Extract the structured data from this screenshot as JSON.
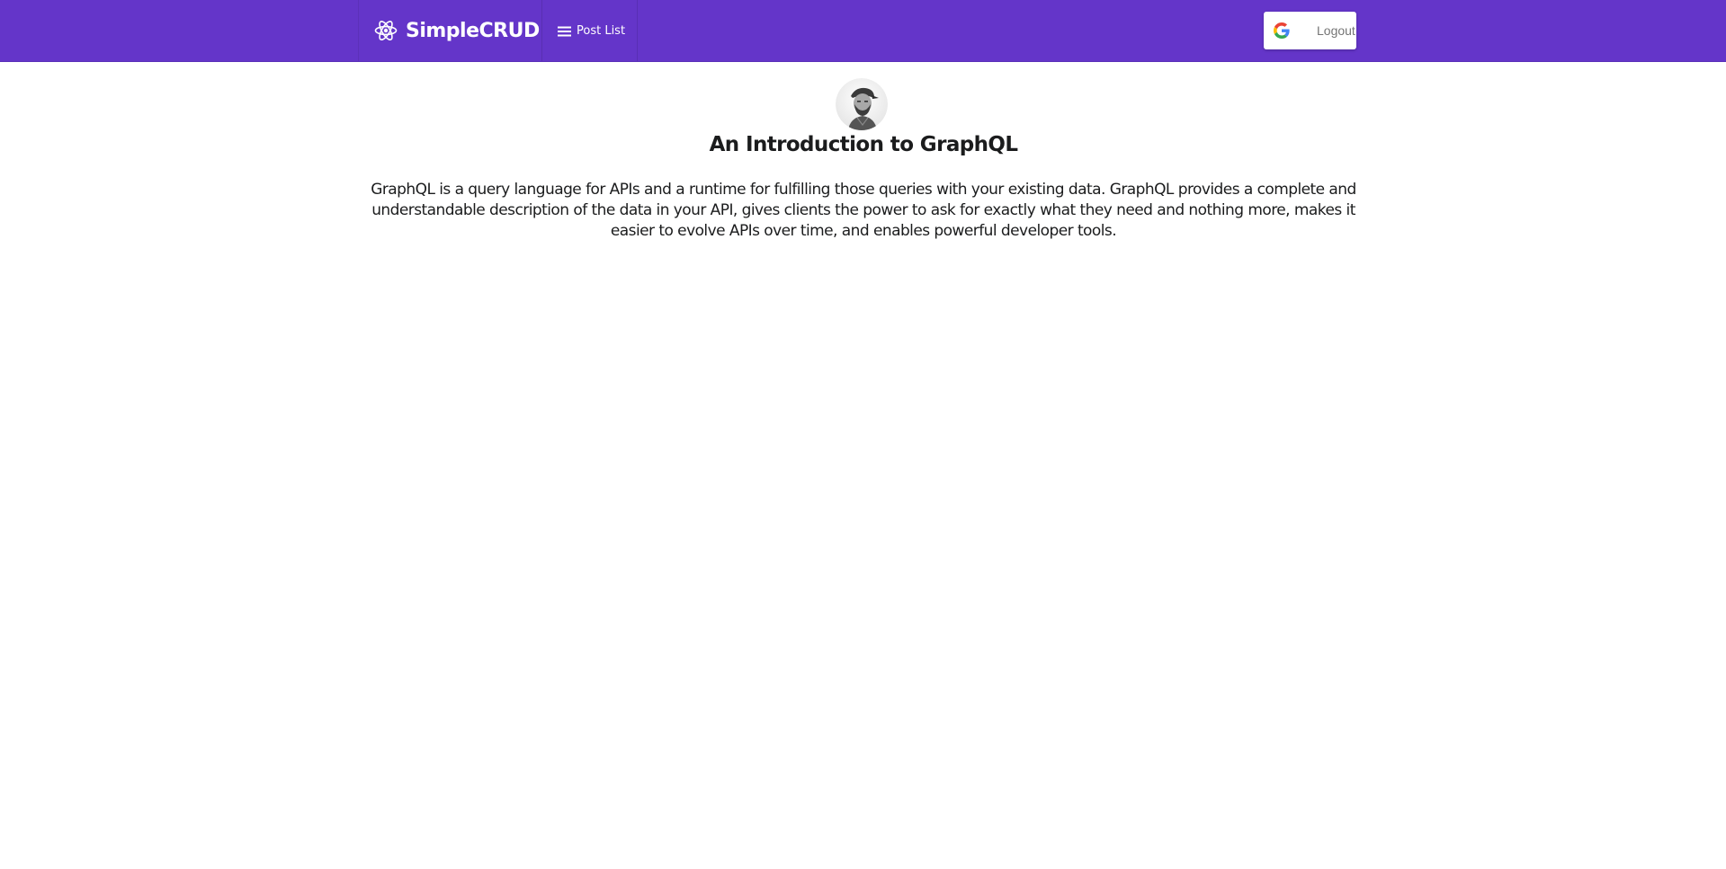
{
  "navbar": {
    "brand_label": "SimpleCRUD",
    "brand_icon": "react-atom-icon",
    "post_list_label": "Post List",
    "post_list_icon": "hamburger-menu-icon",
    "logout_label": "Logout",
    "logout_icon": "google-g-icon",
    "background_color": "#6435c9"
  },
  "post": {
    "avatar": "author-avatar",
    "title": "An Introduction to GraphQL",
    "body": "GraphQL is a query language for APIs and a runtime for fulfilling those queries with your existing data. GraphQL provides a complete and understandable description of the data in your API, gives clients the power to ask for exactly what they need and nothing more, makes it easier to evolve APIs over time, and enables powerful developer tools."
  }
}
